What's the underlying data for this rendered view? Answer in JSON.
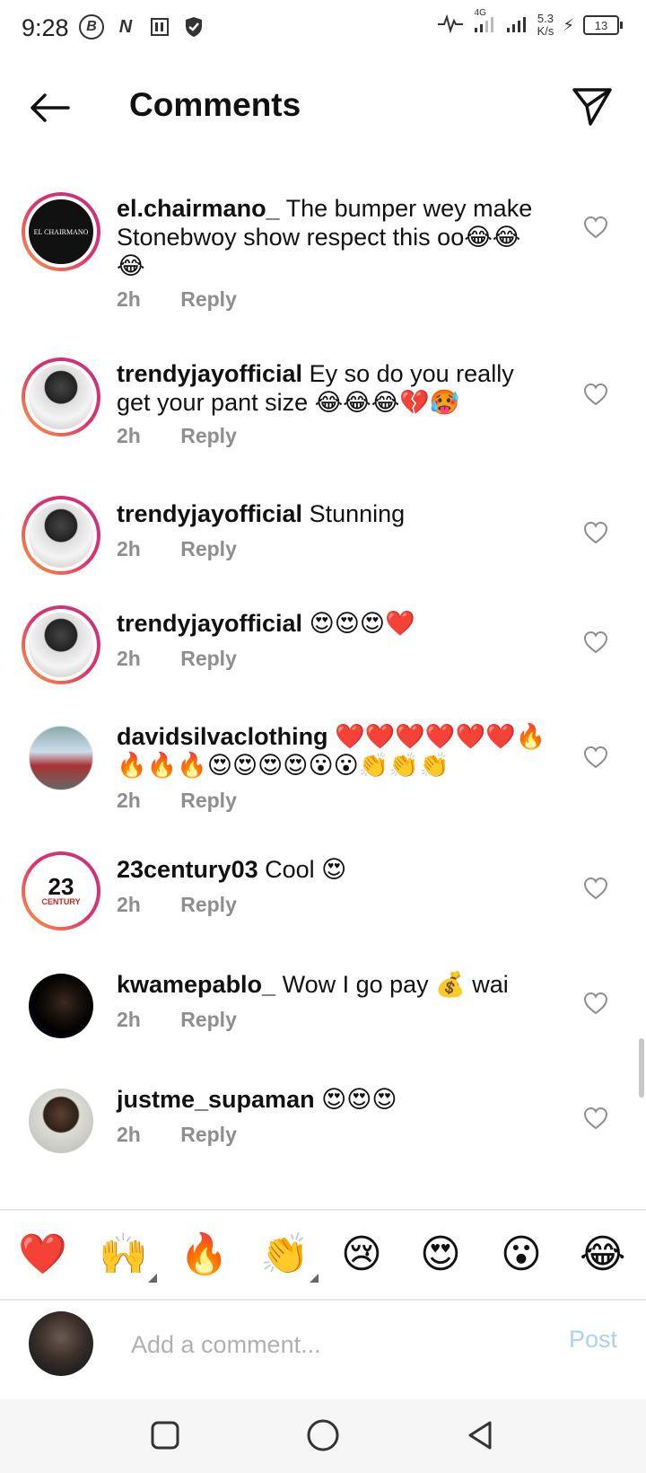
{
  "status_bar": {
    "time": "9:28",
    "network": "4G",
    "speed_value": "5.3",
    "speed_unit": "K/s",
    "battery": "13"
  },
  "header": {
    "title": "Comments",
    "back_icon": "arrow-left-icon",
    "share_icon": "paper-plane-icon"
  },
  "comments": [
    {
      "username": "el.chairmano_",
      "text": "The bumper wey make Stonebwoy show respect this oo😂😂😂",
      "time": "2h",
      "reply": "Reply"
    },
    {
      "username": "trendyjayofficial",
      "text": "Ey so do you really get your pant size 😂😂😂💔🥵",
      "time": "2h",
      "reply": "Reply"
    },
    {
      "username": "trendyjayofficial",
      "text": "Stunning",
      "time": "2h",
      "reply": "Reply"
    },
    {
      "username": "trendyjayofficial",
      "text": "😍😍😍❤️",
      "time": "2h",
      "reply": "Reply"
    },
    {
      "username": "davidsilvaclothing",
      "text": "❤️❤️❤️❤️❤️❤️🔥🔥🔥🔥😍😍😍😍😮😮👏👏👏",
      "time": "2h",
      "reply": "Reply"
    },
    {
      "username": "23century03",
      "text": "Cool 😍",
      "time": "2h",
      "reply": "Reply"
    },
    {
      "username": "kwamepablo_",
      "text": "Wow I go pay 💰 wai",
      "time": "2h",
      "reply": "Reply"
    },
    {
      "username": "justme_supaman",
      "text": "😍😍😍",
      "time": "2h",
      "reply": "Reply"
    }
  ],
  "avatars": {
    "chairmano": "EL CHAIRMANO",
    "century_top": "23",
    "century_bottom": "CENTURY"
  },
  "emoji_bar": [
    "❤️",
    "🙌",
    "🔥",
    "👏",
    "😢",
    "😍",
    "😮",
    "😂"
  ],
  "composer": {
    "placeholder": "Add a comment...",
    "post_label": "Post"
  },
  "colors": {
    "accent_disabled": "#a9d2f5",
    "meta_gray": "#8e8e8e",
    "story_ring_start": "#f9a03f",
    "story_ring_end": "#c13584"
  }
}
